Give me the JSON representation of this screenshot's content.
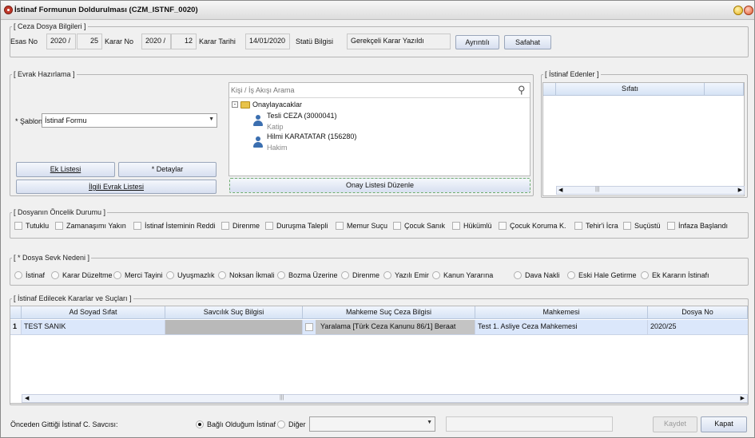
{
  "window": {
    "title": "İstinaf Formunun Doldurulması (CZM_ISTNF_0020)"
  },
  "ceza": {
    "legend": "[ Ceza Dosya Bilgileri ]",
    "esas_label": "Esas No",
    "esas_year": "2020 /",
    "esas_no": "25",
    "karar_label": "Karar No",
    "karar_year": "2020 /",
    "karar_no": "12",
    "karar_tarihi_label": "Karar Tarihi",
    "karar_tarihi": "14/01/2020",
    "statu_label": "Statü Bilgisi",
    "statu": "Gerekçeli Karar Yazıldı",
    "ayrintili": "Ayrıntılı",
    "safahat": "Safahat"
  },
  "evrak": {
    "legend": "[ Evrak Hazırlama ]",
    "sablon_label": "* Şablon",
    "sablon_value": "İstinaf Formu",
    "ek_listesi": "Ek Listesi",
    "detaylar": "* Detaylar",
    "ilgili_evrak": "İlgili Evrak Listesi",
    "search_placeholder": "Kişi / İş Akışı Arama",
    "tree_root": "Onaylayacaklar",
    "persons": [
      {
        "name": "Tesli CEZA (3000041)",
        "role": "Katip"
      },
      {
        "name": "Hilmi KARATATAR (156280)",
        "role": "Hakim"
      }
    ],
    "onay_duzenle": "Onay Listesi Düzenle"
  },
  "istinaf_edenler": {
    "legend": "[ İstinaf Edenler ]",
    "col_sifati": "Sıfatı",
    "scroll_mark": "|||"
  },
  "oncelik": {
    "legend": "[ Dosyanın Öncelik Durumu ]",
    "items": [
      "Tutuklu",
      "Zamanaşımı Yakın",
      "İstinaf İsteminin Reddi",
      "Direnme",
      "Duruşma Talepli",
      "Memur Suçu",
      "Çocuk Sanık",
      "Hükümlü",
      "Çocuk Koruma K.",
      "Tehir'i İcra",
      "Suçüstü",
      "İnfaza Başlandı"
    ]
  },
  "sevk": {
    "legend": "[ * Dosya Sevk Nedeni ]",
    "items": [
      "İstinaf",
      "Karar Düzeltme",
      "Merci Tayini",
      "Uyuşmazlık",
      "Noksan İkmali",
      "Bozma Üzerine",
      "Direnme",
      "Yazılı Emir",
      "Kanun Yararına",
      "Dava Nakli",
      "Eski Hale Getirme",
      "Ek Kararın İstinafı"
    ]
  },
  "kararlar": {
    "legend": "[ İstinaf Edilecek Kararlar ve Suçları ]",
    "columns": [
      "Ad Soyad Sıfat",
      "Savcılık Suç Bilgisi",
      "Mahkeme Suç Ceza Bilgisi",
      "Mahkemesi",
      "Dosya No"
    ],
    "rows": [
      {
        "num": "1",
        "ad": "TEST SANIK",
        "savcilik": "",
        "mahkeme_suc": "Yaralama [Türk Ceza Kanunu 86/1] Beraat",
        "mahkemesi": "Test 1. Asliye Ceza Mahkemesi",
        "dosya": "2020/25"
      }
    ],
    "scroll_mark": "|||"
  },
  "footer": {
    "savci_label": "Önceden Gittiği İstinaf C. Savcısı:",
    "bagli": "Bağlı Olduğum İstinaf",
    "diger": "Diğer",
    "kaydet": "Kaydet",
    "kapat": "Kapat"
  }
}
